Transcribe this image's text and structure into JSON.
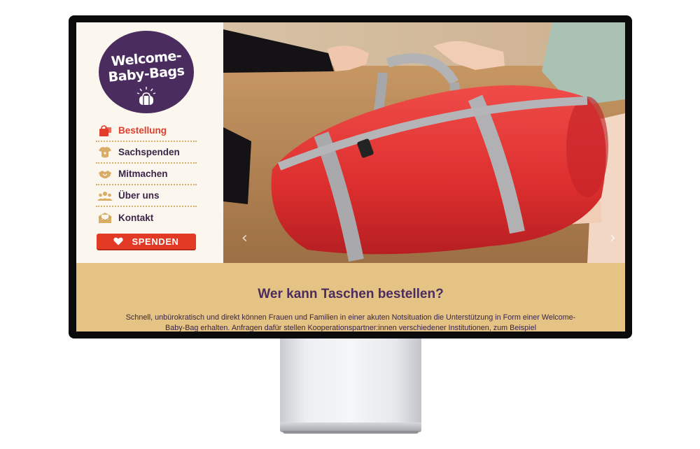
{
  "logo": {
    "line1": "Welcome-",
    "line2": "Baby-Bags"
  },
  "nav": {
    "items": [
      {
        "label": "Bestellung",
        "icon": "shopping-bag-icon",
        "active": true
      },
      {
        "label": "Sachspenden",
        "icon": "baby-onesie-icon",
        "active": false
      },
      {
        "label": "Mitmachen",
        "icon": "handshake-icon",
        "active": false
      },
      {
        "label": "Über uns",
        "icon": "group-icon",
        "active": false
      },
      {
        "label": "Kontakt",
        "icon": "envelope-icon",
        "active": false
      }
    ],
    "donate_label": "SPENDEN"
  },
  "hero": {
    "prev_icon": "chevron-left-icon",
    "next_icon": "chevron-right-icon",
    "prev_glyph": "‹",
    "next_glyph": "›"
  },
  "content": {
    "heading": "Wer kann Taschen bestellen?",
    "paragraph": "Schnell, unbürokratisch und direkt können Frauen und Familien in einer akuten Notsituation die Unterstützung in Form einer Welcome-Baby-Bag erhalten. Anfragen dafür stellen Kooperationspartner:innen verschiedener Institutionen, zum Beispiel"
  },
  "colors": {
    "accent": "#e33a26",
    "brand_purple": "#4a2c5e",
    "sand": "#e4c384",
    "cream": "#fbf7ee"
  }
}
